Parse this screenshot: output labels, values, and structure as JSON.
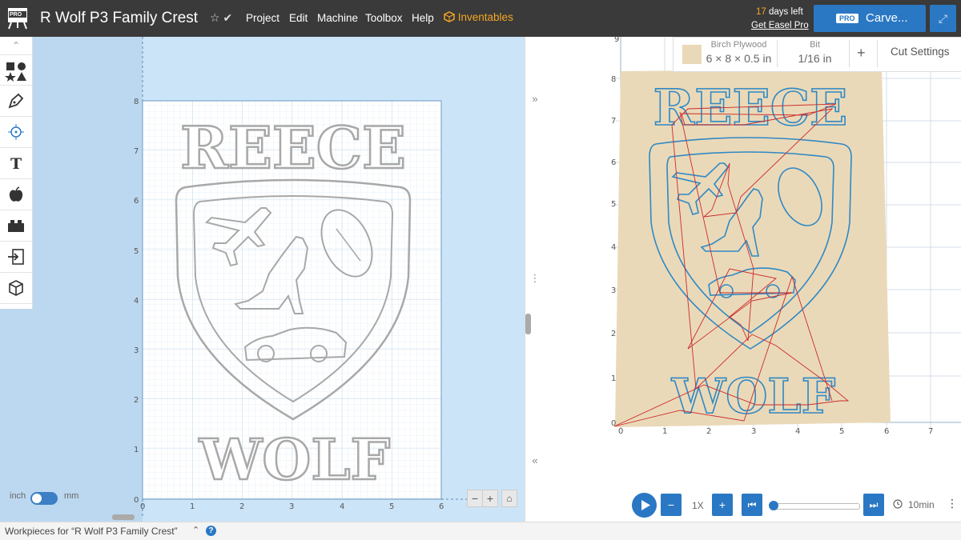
{
  "app": {
    "title": "R Wolf P3 Family Crest",
    "logo_badge": "PRO",
    "star_icon": "☆",
    "check_icon": "✔"
  },
  "menu": [
    "Project",
    "Edit",
    "Machine",
    "Toolbox",
    "Help"
  ],
  "inventables": "Inventables",
  "trial": {
    "days_num": "17",
    "days_text": "days left",
    "link": "Get Easel Pro"
  },
  "carve": {
    "badge": "PRO",
    "label": "Carve..."
  },
  "units": {
    "left": "inch",
    "right": "mm"
  },
  "zoom": {
    "minus": "−",
    "plus": "+",
    "home": "⌂"
  },
  "design": {
    "lines": [
      "REECE",
      "WOLF"
    ],
    "x_ticks": [
      "0",
      "1",
      "2",
      "3",
      "4",
      "5",
      "6"
    ],
    "y_ticks": [
      "0",
      "1",
      "2",
      "3",
      "4",
      "5",
      "6",
      "7",
      "8"
    ]
  },
  "material": {
    "name": "Birch Plywood",
    "size": "6 × 8 × 0.5 in"
  },
  "bit": {
    "label": "Bit",
    "size": "1/16 in"
  },
  "add": "+",
  "cut_settings": "Cut Settings",
  "preview": {
    "x_ticks": [
      "0",
      "1",
      "2",
      "3",
      "4",
      "5",
      "6",
      "7"
    ],
    "y_ticks": [
      "0",
      "1",
      "2",
      "3",
      "4",
      "5",
      "6",
      "7",
      "8",
      "9"
    ]
  },
  "playback": {
    "speed": "1X",
    "time": "10min",
    "minus": "−",
    "plus": "+",
    "rewind": "⏮",
    "forward": "⏭",
    "more": "⋮"
  },
  "status": {
    "workpieces": "Workpieces for “R Wolf P3 Family Crest”",
    "chevron": "⌃",
    "help": "?"
  },
  "colors": {
    "accent": "#2a78c4",
    "orange": "#f5a623",
    "wood": "#ead9b8",
    "toolpath": "#2f89c5",
    "travel": "#cc2a2a"
  },
  "icons": [
    "shapes-icon",
    "pen-icon",
    "crosshair-icon",
    "text-icon",
    "apple-icon",
    "lego-icon",
    "import-icon",
    "cube-icon"
  ],
  "panel_arrows": {
    "collapse": "»",
    "grip": "⋮",
    "expand": "«",
    "top": "⌃"
  }
}
